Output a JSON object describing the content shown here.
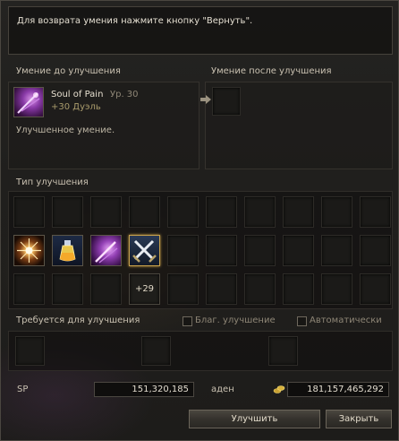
{
  "message": "Для возврата умения нажмите кнопку \"Вернуть\".",
  "before": {
    "header": "Умение до улучшения",
    "skill_name": "Soul of Pain",
    "skill_level": "Ур. 30",
    "skill_enchant": "+30 Дуэль",
    "status": "Улучшенное умение.",
    "icon": "soul-of-pain-icon"
  },
  "after": {
    "header": "Умение после улучшения",
    "arrow_icon": "arrow-right-icon"
  },
  "enchant_type": {
    "header": "Тип улучшения",
    "routes": [
      {
        "icon": "starburst-icon",
        "label": ""
      },
      {
        "icon": "potion-icon",
        "label": ""
      },
      {
        "icon": "purple-sword-icon",
        "label": ""
      },
      {
        "icon": "crossed-swords-icon",
        "label": "",
        "selected": true
      }
    ],
    "selected_badge": "+29"
  },
  "requirements": {
    "header": "Требуется для улучшения",
    "blessed_label": "Благ. улучшение",
    "auto_label": "Автоматически"
  },
  "stats": {
    "sp_label": "SP",
    "sp_value": "151,320,185",
    "adena_label": "аден",
    "adena_value": "181,157,465,292",
    "adena_icon": "coins-icon"
  },
  "buttons": {
    "enchant": "Улучшить",
    "close": "Закрыть"
  },
  "colors": {
    "accent_gold": "#b9a36a",
    "enchant_text": "#a89a6b"
  }
}
